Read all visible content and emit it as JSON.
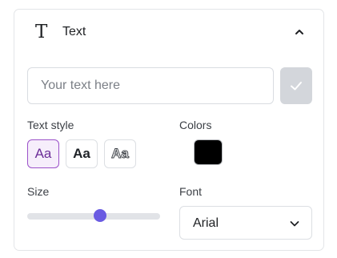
{
  "panel": {
    "title": "Text",
    "header_icon": "text-t-icon",
    "collapse_icon": "chevron-up-icon"
  },
  "text_input": {
    "value": "",
    "placeholder": "Your text here"
  },
  "apply_button": {
    "icon": "check-icon",
    "color": "#d3d6db"
  },
  "text_style": {
    "label": "Text style",
    "options": [
      {
        "label": "Aa",
        "style": "regular",
        "selected": true
      },
      {
        "label": "Aa",
        "style": "bold",
        "selected": false
      },
      {
        "label": "Aa",
        "style": "outline",
        "selected": false
      }
    ],
    "accent_color": "#9b51c9"
  },
  "colors": {
    "label": "Colors",
    "selected": "#000000"
  },
  "size": {
    "label": "Size",
    "value_fraction": 0.55,
    "thumb_color": "#6a5be2"
  },
  "font": {
    "label": "Font",
    "selected": "Arial",
    "chevron_icon": "chevron-down-icon"
  }
}
